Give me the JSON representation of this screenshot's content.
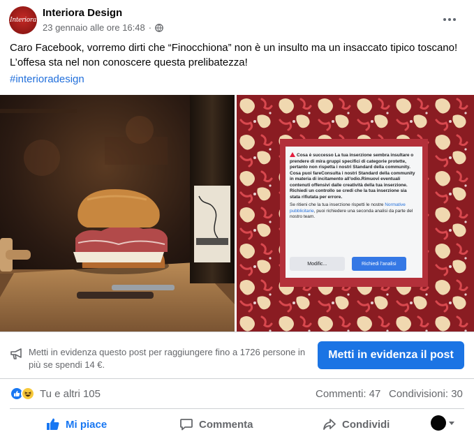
{
  "post": {
    "page_name": "Interiora Design",
    "logo_text": "Interiora",
    "timestamp": "23 gennaio alle ore 16:48",
    "separator": "·",
    "text": "Caro Facebook, vorremo dirti che “Finocchiona” non è un insulto ma un insaccato tipico toscano! L’offesa sta nel non conoscere questa prelibatezza!",
    "hashtag": "#interioradesign"
  },
  "dialog": {
    "warning": "Cosa è successo La tua inserzione sembra insultare o prendere di mira gruppi specifici di categorie protette, pertanto non rispetta i nostri Standard della community. Cosa puoi fareConsulta i nostri Standard della community in materia di incitamento all'odio.Rimuovi eventuali contenuti offensivi dalle creatività della tua inserzione. Richiedi un controllo se credi che la tua inserzione sia stata rifiutata per errore.",
    "note_before": "Se ritieni che la tua inserzione rispetti le nostre",
    "note_link": "Normative pubblicitarie",
    "note_after": ", puoi richiedere una seconda analisi da parte del nostro team.",
    "modify_label": "Modific...",
    "review_label": "Richiedi l'analisi"
  },
  "boost": {
    "text": "Metti in evidenza questo post per raggiungere fino a 1726 persone in più se spendi 14 €.",
    "button_label": "Metti in evidenza il post"
  },
  "reactions": {
    "label": "Tu e altri 105",
    "comments": "Commenti: 47",
    "shares": "Condivisioni: 30"
  },
  "actions": {
    "like": "Mi piace",
    "comment": "Commenta",
    "share": "Condividi"
  },
  "colors": {
    "accent": "#1877f2",
    "boost_button": "#1b74e4",
    "dialog_frame": "#b3303a",
    "pattern_bg": "#8a1c22"
  },
  "icons": {
    "globe": "globe-icon",
    "more": "more-icon",
    "megaphone": "megaphone-icon",
    "like": "thumbs-up-icon",
    "comment": "comment-icon",
    "share": "share-icon"
  }
}
